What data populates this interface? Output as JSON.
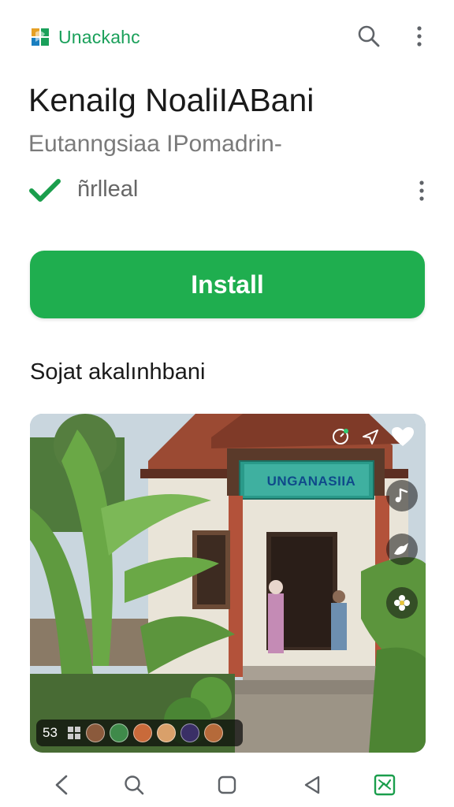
{
  "header": {
    "brand_name": "Unackahc",
    "icons": [
      "app-logo-icon",
      "search-icon",
      "more-vert-icon"
    ]
  },
  "app": {
    "title": "Kenailg NoaliIABani",
    "subtitle": "Eutanngsiaa IPomadrin-",
    "status_text": "ñrlleal",
    "install_label": "Install"
  },
  "screenshots": {
    "section_title": "Sojat akalınhbani",
    "sign_text": "UNGANASIIA",
    "strip_count": "53"
  },
  "nav": {
    "icons": [
      "back-icon",
      "search-icon",
      "home-icon",
      "recents-icon",
      "app-icon"
    ]
  },
  "colors": {
    "accent": "#1fae4f",
    "brand_text": "#1aa05a",
    "subtitle_text": "#7a7a7a"
  }
}
